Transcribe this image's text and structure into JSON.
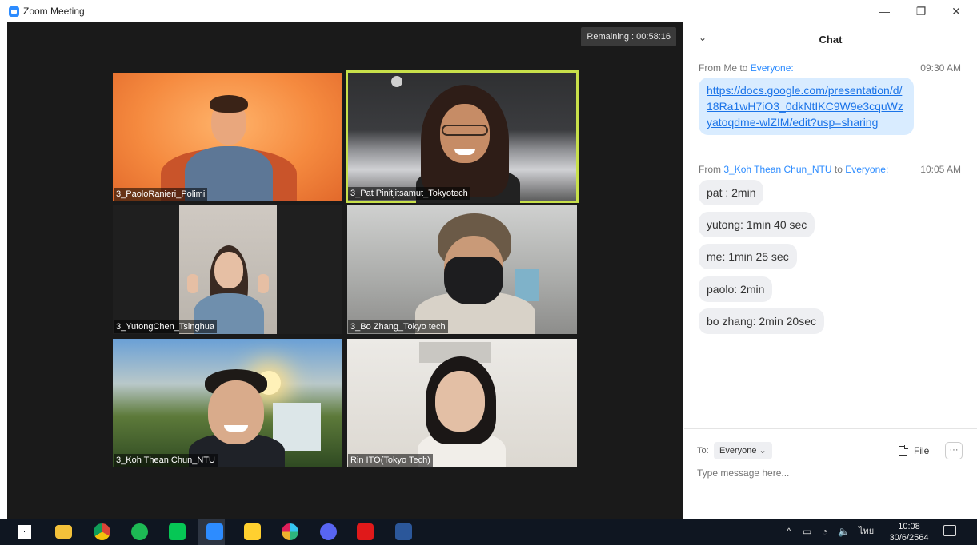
{
  "window": {
    "title": "Zoom Meeting",
    "minimize": "—",
    "restore": "❐",
    "close": "✕"
  },
  "meeting": {
    "remaining": "Remaining : 00:58:16"
  },
  "participants": [
    {
      "name": "3_PaoloRanieri_Polimi",
      "active": false
    },
    {
      "name": "3_Pat Pinitjitsamut_Tokyotech",
      "active": true
    },
    {
      "name": "3_YutongChen_Tsinghua",
      "active": false
    },
    {
      "name": "3_Bo Zhang_Tokyo tech",
      "active": false
    },
    {
      "name": "3_Koh Thean Chun_NTU",
      "active": false
    },
    {
      "name": "Rin ITO(Tokyo Tech)",
      "active": false
    }
  ],
  "chat": {
    "title": "Chat",
    "messages": [
      {
        "from_prefix": "From Me to",
        "from": "",
        "to_prefix": "",
        "to": "Everyone:",
        "time": "09:30 AM",
        "text": "https://docs.google.com/presentation/d/18Ra1wH7iO3_0dkNtIKC9W9e3cquWzyatoqdme-wlZIM/edit?usp=sharing"
      },
      {
        "from_prefix": "From",
        "from": "3_Koh Thean Chun_NTU",
        "to_prefix": "to",
        "to": "Everyone:",
        "time": "10:05 AM",
        "lines": [
          "pat : 2min",
          "yutong: 1min 40 sec",
          "me: 1min 25 sec",
          "paolo: 2min",
          "bo zhang: 2min 20sec"
        ]
      }
    ],
    "to_label": "To:",
    "to_value": "Everyone",
    "file_label": "File",
    "more_label": "···",
    "input_placeholder": "Type message here..."
  },
  "taskbar": {
    "apps": [
      "windows-start",
      "file-explorer",
      "chrome",
      "spotify",
      "line",
      "zoom",
      "miro",
      "slack",
      "discord",
      "acrobat",
      "word"
    ],
    "language": "ไทย",
    "time": "10:08",
    "date": "30/6/2564"
  }
}
